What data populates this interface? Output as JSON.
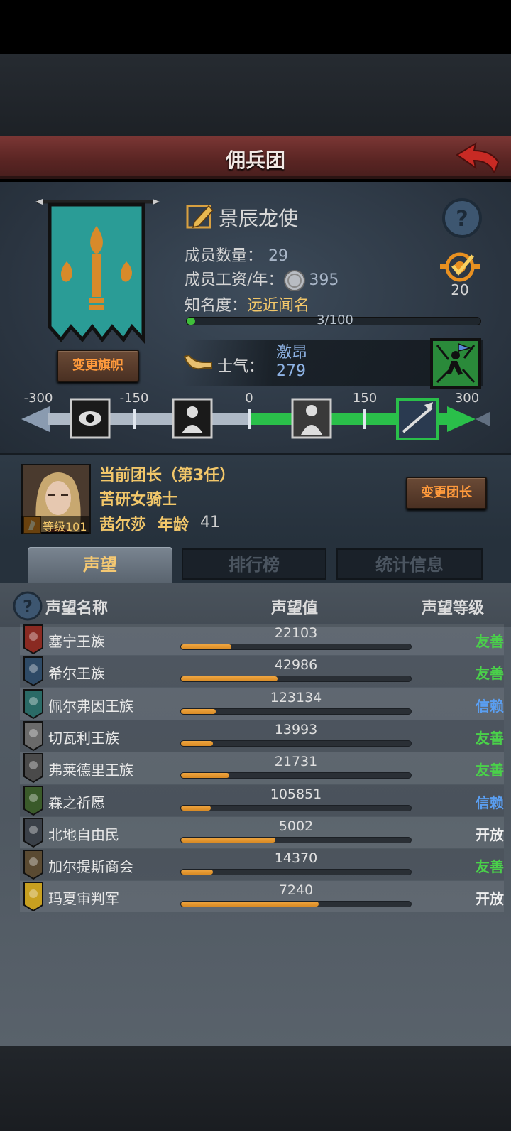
{
  "header": {
    "title": "佣兵团"
  },
  "company": {
    "name": "景辰龙使",
    "members_label": "成员数量：",
    "members_value": "29",
    "wage_label": "成员工资/年：",
    "wage_value": "395",
    "fame_label": "知名度：",
    "fame_title": "远近闻名",
    "fame_count": "3/100",
    "fame_progress": 0.03,
    "badge_value": "20",
    "change_banner_label": "变更旗帜"
  },
  "morale": {
    "label": "士气：",
    "status": "激昂",
    "value": "279",
    "scale_ticks": [
      "-300",
      "-150",
      "0",
      "150",
      "300"
    ]
  },
  "leader": {
    "title": "当前团长（第3任）",
    "class": "苦研女骑士",
    "name": "茜尔莎",
    "age_label": "年龄",
    "age": "41",
    "level": "等级101",
    "change_leader_label": "变更团长"
  },
  "tabs": [
    {
      "label": "声望"
    },
    {
      "label": "排行榜"
    },
    {
      "label": "统计信息"
    }
  ],
  "reputation": {
    "col_name": "声望名称",
    "col_value": "声望值",
    "col_level": "声望等级",
    "rows": [
      {
        "name": "塞宁王族",
        "value": "22103",
        "progress": 0.22,
        "level": "友善",
        "level_color": "#4ad04a",
        "crest_color": "#8a2a22"
      },
      {
        "name": "希尔王族",
        "value": "42986",
        "progress": 0.42,
        "level": "友善",
        "level_color": "#4ad04a",
        "crest_color": "#2e4a66"
      },
      {
        "name": "佩尔弗因王族",
        "value": "123134",
        "progress": 0.15,
        "level": "信赖",
        "level_color": "#5a9ef0",
        "crest_color": "#2a6a66"
      },
      {
        "name": "切瓦利王族",
        "value": "13993",
        "progress": 0.14,
        "level": "友善",
        "level_color": "#4ad04a",
        "crest_color": "#6a6a6a"
      },
      {
        "name": "弗莱德里王族",
        "value": "21731",
        "progress": 0.21,
        "level": "友善",
        "level_color": "#4ad04a",
        "crest_color": "#4a4a4a"
      },
      {
        "name": "森之祈愿",
        "value": "105851",
        "progress": 0.13,
        "level": "信赖",
        "level_color": "#5a9ef0",
        "crest_color": "#3a5a2a"
      },
      {
        "name": "北地自由民",
        "value": "5002",
        "progress": 0.41,
        "level": "开放",
        "level_color": "#f0f0f0",
        "crest_color": "#3a4048"
      },
      {
        "name": "加尔提斯商会",
        "value": "14370",
        "progress": 0.14,
        "level": "友善",
        "level_color": "#4ad04a",
        "crest_color": "#5a4a32"
      },
      {
        "name": "玛夏审判军",
        "value": "7240",
        "progress": 0.6,
        "level": "开放",
        "level_color": "#f0f0f0",
        "crest_color": "#c8a020"
      }
    ]
  }
}
